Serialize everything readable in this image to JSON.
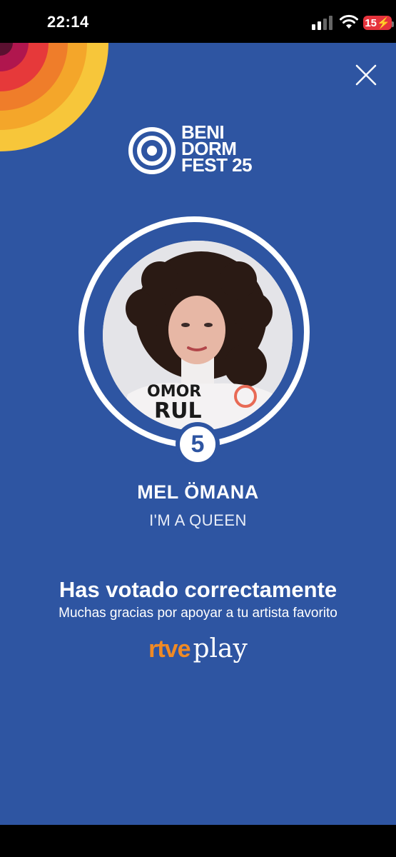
{
  "status_bar": {
    "time": "22:14",
    "battery": "15"
  },
  "header": {
    "close_icon": "close-icon",
    "logo": {
      "line1": "BENI",
      "line2": "DORM",
      "line3": "FEST 25"
    }
  },
  "artist": {
    "number": "5",
    "name": "MEL ÖMANA",
    "song": "I'M A QUEEN"
  },
  "confirmation": {
    "title": "Has votado correctamente",
    "subtitle": "Muchas gracias por apoyar a tu artista favorito"
  },
  "brand": {
    "rtve": "rtve",
    "play": "play"
  },
  "colors": {
    "background": "#2e55a2",
    "accent_orange": "#f08a24",
    "sun_yellow": "#f7c63a",
    "sun_red": "#e6393a",
    "sun_magenta": "#b0164e"
  }
}
